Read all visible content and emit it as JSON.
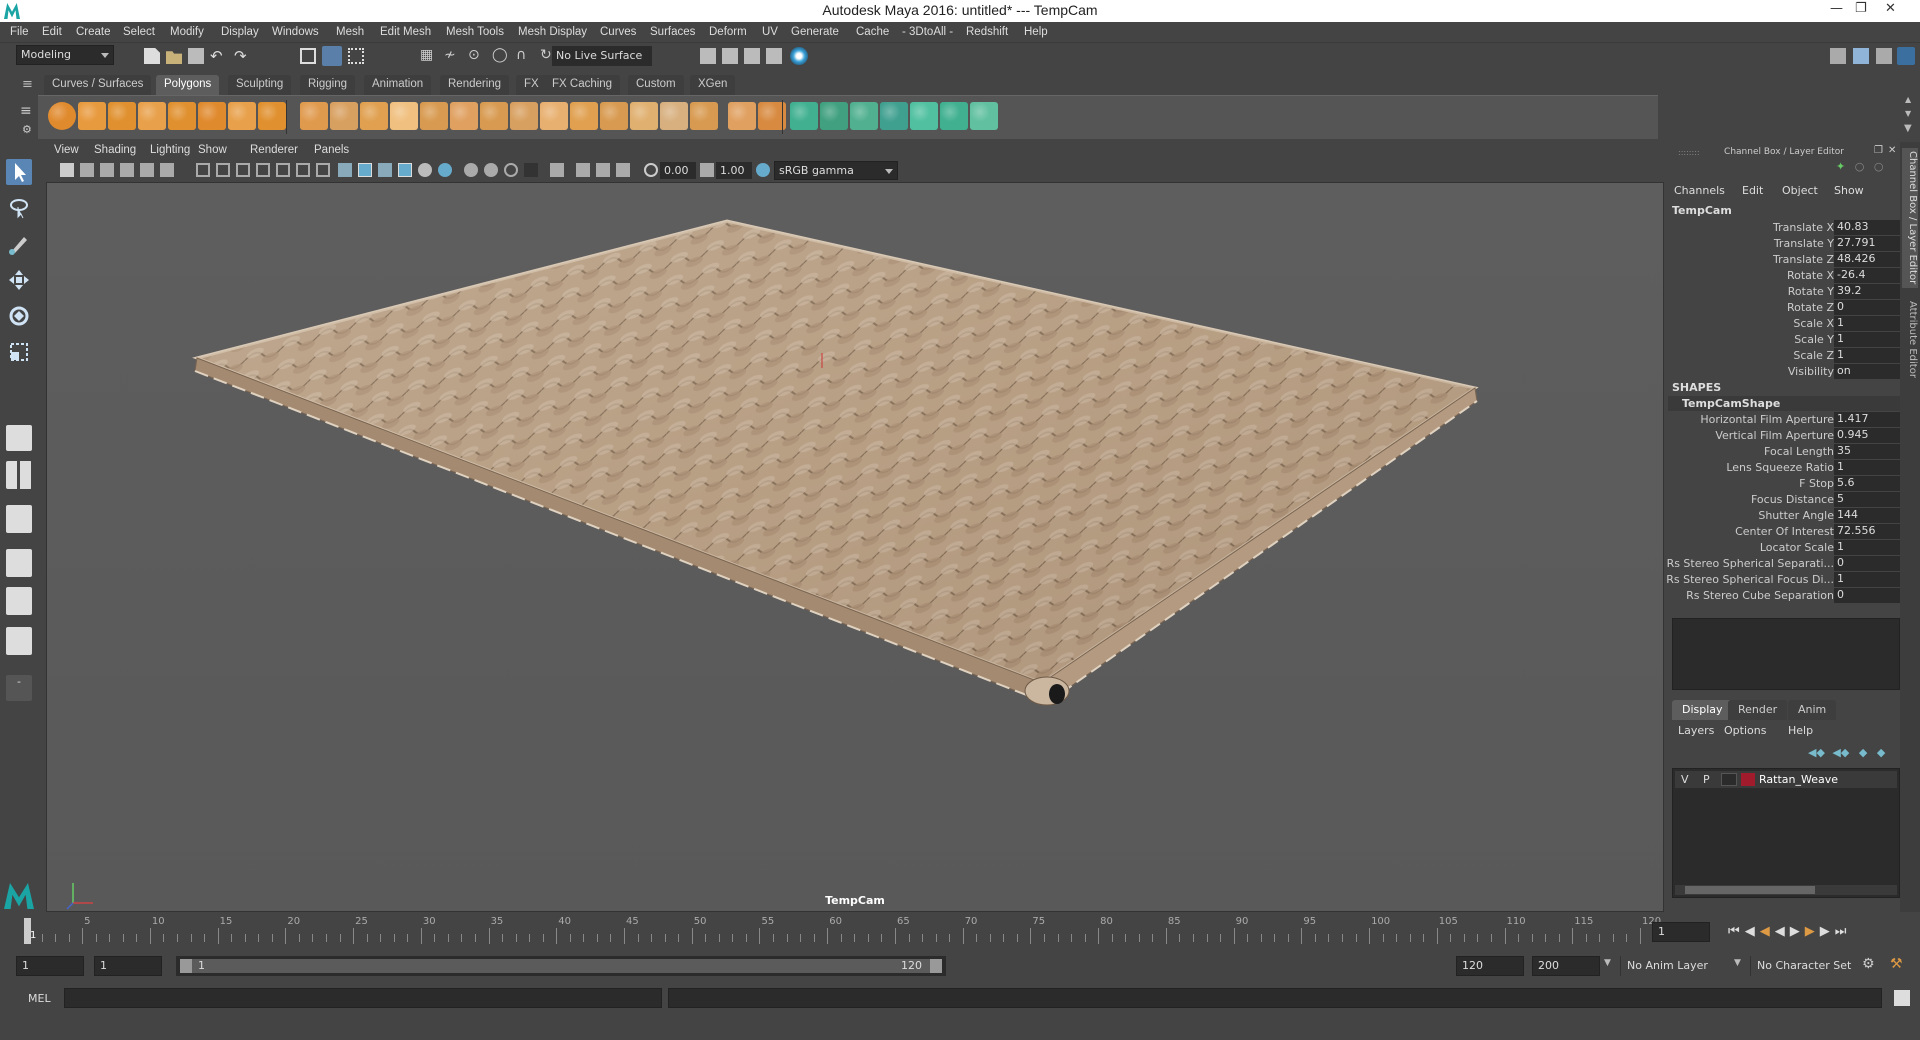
{
  "window": {
    "title": "Autodesk Maya 2016: untitled*   ---   TempCam"
  },
  "menubar": [
    "File",
    "Edit",
    "Create",
    "Select",
    "Modify",
    "Display",
    "Windows",
    "Mesh",
    "Edit Mesh",
    "Mesh Tools",
    "Mesh Display",
    "Curves",
    "Surfaces",
    "Deform",
    "UV",
    "Generate",
    "Cache",
    "- 3DtoAll -",
    "Redshift",
    "Help"
  ],
  "statusline": {
    "menuset": "Modeling",
    "live_surface": "No Live Surface"
  },
  "shelf_tabs": [
    "Curves / Surfaces",
    "Polygons",
    "Sculpting",
    "Rigging",
    "Animation",
    "Rendering",
    "FX",
    "FX Caching",
    "Custom",
    "XGen"
  ],
  "shelf_active": "Polygons",
  "viewport": {
    "menu": [
      "View",
      "Shading",
      "Lighting",
      "Show",
      "Renderer",
      "Panels"
    ],
    "exposure": "0.00",
    "gamma": "1.00",
    "color_space": "sRGB gamma",
    "camera_label": "TempCam"
  },
  "channel_box": {
    "header": "Channel Box / Layer Editor",
    "menu": [
      "Channels",
      "Edit",
      "Object",
      "Show"
    ],
    "object": "TempCam",
    "channels": [
      {
        "label": "Translate X",
        "value": "40.83"
      },
      {
        "label": "Translate Y",
        "value": "27.791"
      },
      {
        "label": "Translate Z",
        "value": "48.426"
      },
      {
        "label": "Rotate X",
        "value": "-26.4"
      },
      {
        "label": "Rotate Y",
        "value": "39.2"
      },
      {
        "label": "Rotate Z",
        "value": "0"
      },
      {
        "label": "Scale X",
        "value": "1"
      },
      {
        "label": "Scale Y",
        "value": "1"
      },
      {
        "label": "Scale Z",
        "value": "1"
      },
      {
        "label": "Visibility",
        "value": "on"
      }
    ],
    "shapes_header": "SHAPES",
    "shape_name": "TempCamShape",
    "shape_channels": [
      {
        "label": "Horizontal Film Aperture",
        "value": "1.417"
      },
      {
        "label": "Vertical Film Aperture",
        "value": "0.945"
      },
      {
        "label": "Focal Length",
        "value": "35"
      },
      {
        "label": "Lens Squeeze Ratio",
        "value": "1"
      },
      {
        "label": "F Stop",
        "value": "5.6"
      },
      {
        "label": "Focus Distance",
        "value": "5"
      },
      {
        "label": "Shutter Angle",
        "value": "144"
      },
      {
        "label": "Center Of Interest",
        "value": "72.556"
      },
      {
        "label": "Locator Scale",
        "value": "1"
      },
      {
        "label": "Rs Stereo Spherical Separati...",
        "value": "0"
      },
      {
        "label": "Rs Stereo Spherical Focus Di...",
        "value": "1"
      },
      {
        "label": "Rs Stereo Cube Separation",
        "value": "0"
      }
    ]
  },
  "layer_editor": {
    "tabs": [
      "Display",
      "Render",
      "Anim"
    ],
    "menu": [
      "Layers",
      "Options",
      "Help"
    ],
    "layer": {
      "v": "V",
      "p": "P",
      "name": "Rattan_Weave",
      "color": "#a01c2c"
    }
  },
  "side_tabs": [
    "Channel Box / Layer Editor",
    "Attribute Editor"
  ],
  "timeline": {
    "ticks": [
      "1",
      "5",
      "10",
      "15",
      "20",
      "25",
      "30",
      "35",
      "40",
      "45",
      "50",
      "55",
      "60",
      "65",
      "70",
      "75",
      "80",
      "85",
      "90",
      "95",
      "100",
      "105",
      "110",
      "115",
      "120"
    ],
    "current_frame": "1"
  },
  "range": {
    "start": "1",
    "anim_start": "1",
    "slider_start": "1",
    "slider_end": "120",
    "anim_end": "120",
    "end": "200",
    "anim_layer": "No Anim Layer",
    "character_set": "No Character Set"
  },
  "cmdline": {
    "mode": "MEL"
  }
}
